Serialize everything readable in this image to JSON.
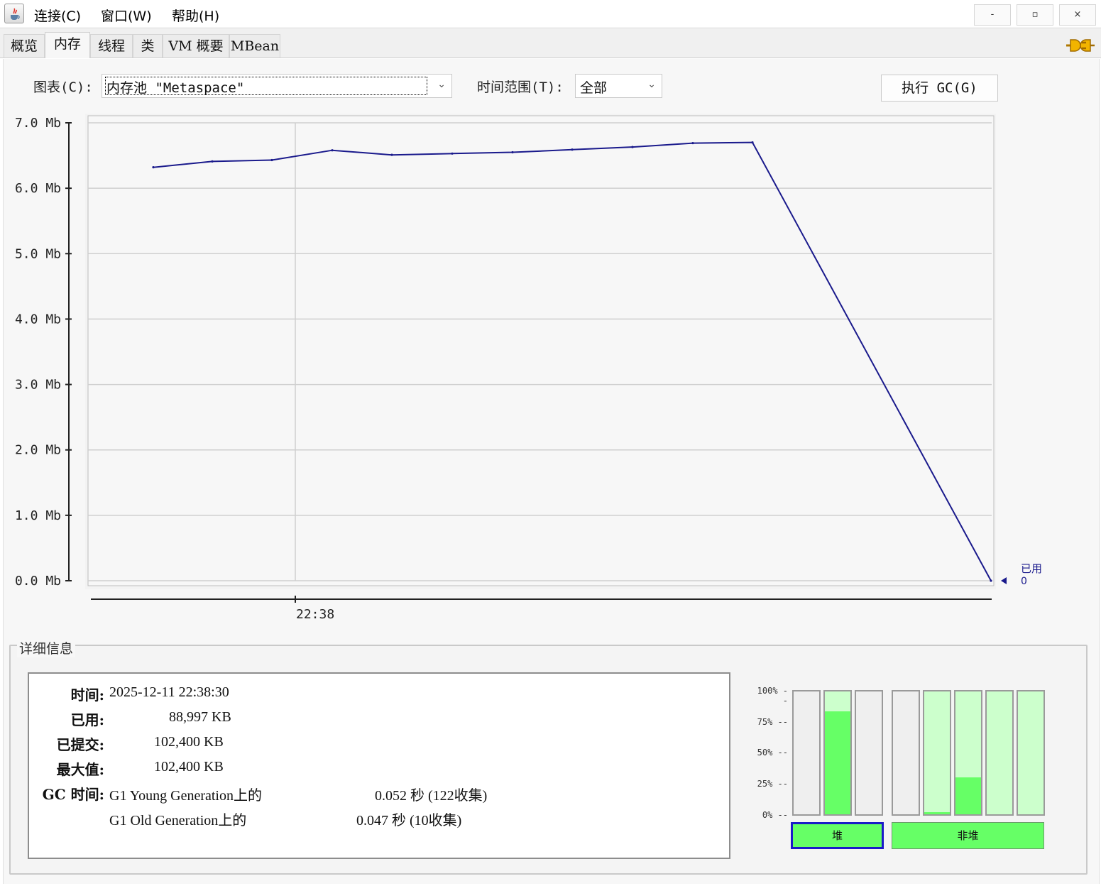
{
  "menu": {
    "items": [
      "连接(C)",
      "窗口(W)",
      "帮助(H)"
    ],
    "window_controls": [
      "-",
      "▫",
      "×"
    ]
  },
  "tabs": [
    "概览",
    "内存",
    "线程",
    "类",
    "VM 概要",
    "MBean"
  ],
  "active_tab": "内存",
  "toolbar": {
    "chart_label": "图表(C):",
    "chart_value": "内存池 \"Metaspace\"",
    "time_range_label": "时间范围(T):",
    "time_range_value": "全部",
    "gc_button": "执行 GC(G)"
  },
  "chart_data": {
    "type": "line",
    "series": [
      {
        "name": "已用",
        "color": "#1a1a8c",
        "values": [
          6.32,
          6.41,
          6.43,
          6.58,
          6.51,
          6.53,
          6.55,
          6.59,
          6.63,
          6.69,
          6.7,
          0.0
        ]
      }
    ],
    "x_tick_labels": [
      "22:38"
    ],
    "y_tick_labels": [
      "0.0 Mb",
      "1.0 Mb",
      "2.0 Mb",
      "3.0 Mb",
      "4.0 Mb",
      "5.0 Mb",
      "6.0 Mb",
      "7.0 Mb"
    ],
    "ylim": [
      0,
      7
    ],
    "grid": true,
    "legend": {
      "label": "已用",
      "value": "0",
      "position": "right"
    }
  },
  "details": {
    "title": "详细信息",
    "time_key": "时间:",
    "time_value": "2025-12-11 22:38:30",
    "used_key": "已用:",
    "used_value": "88,997 KB",
    "committed_key": "已提交:",
    "committed_value": "102,400 KB",
    "max_key": "最大值:",
    "max_value": "102,400 KB",
    "gc_key": "GC 时间:",
    "gc_rows": [
      {
        "name": "G1 Young Generation上的",
        "time": "0.052 秒 (122收集)"
      },
      {
        "name": "G1 Old Generation上的",
        "time": "0.047 秒 (10收集)"
      }
    ]
  },
  "pools": {
    "scale": [
      "100% --",
      "75% --",
      "50% --",
      "25% --",
      "0% --"
    ],
    "heap_label": "堆",
    "nonheap_label": "非堆",
    "heap": [
      {
        "used": 0.0,
        "committed": 0.0
      },
      {
        "used": 0.84,
        "committed": 1.0
      },
      {
        "used": 0.0,
        "committed": 0.0
      }
    ],
    "nonheap": [
      {
        "used": 0.0,
        "committed": 0.0
      },
      {
        "used": 0.02,
        "committed": 1.0
      },
      {
        "used": 0.3,
        "committed": 1.0
      },
      {
        "used": 0.0,
        "committed": 1.0
      },
      {
        "used": 0.0,
        "committed": 1.0
      }
    ],
    "colors": {
      "used": "#66ff66",
      "committed": "#ccffcc",
      "empty": "#efefef"
    }
  }
}
